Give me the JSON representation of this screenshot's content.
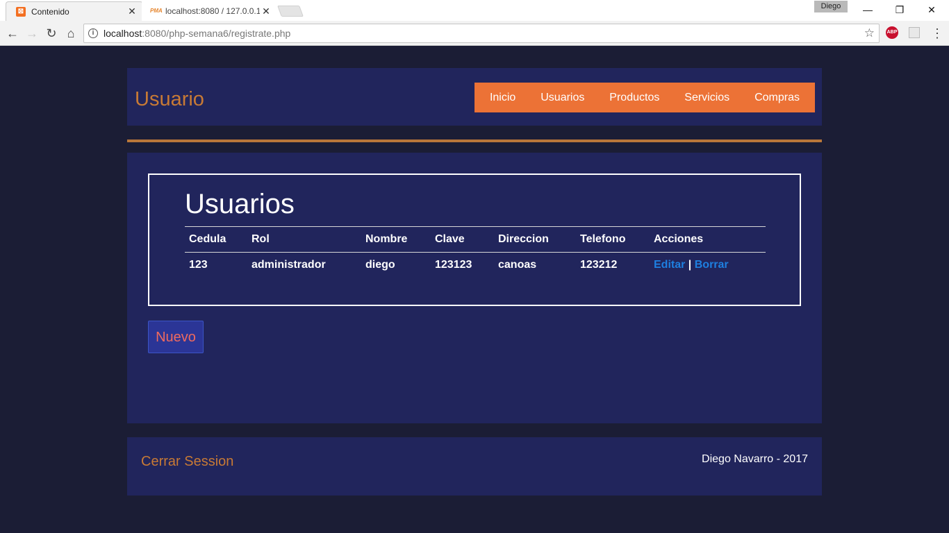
{
  "browser": {
    "tabs": [
      {
        "title": "Contenido",
        "icon": "xampp-icon",
        "active": true
      },
      {
        "title": "localhost:8080 / 127.0.0.1",
        "icon": "phpmyadmin-icon",
        "active": false
      }
    ],
    "profile_name": "Diego",
    "url_host": "localhost",
    "url_path": ":8080/php-semana6/registrate.php",
    "abp_label": "ABP",
    "favicon_xampp_glyph": "⊠",
    "favicon_pma_text": "PMA"
  },
  "header": {
    "site_title": "Usuario",
    "nav": [
      "Inicio",
      "Usuarios",
      "Productos",
      "Servicios",
      "Compras"
    ]
  },
  "main": {
    "title": "Usuarios",
    "columns": [
      "Cedula",
      "Rol",
      "Nombre",
      "Clave",
      "Direccion",
      "Telefono",
      "Acciones"
    ],
    "rows": [
      {
        "cedula": "123",
        "rol": "administrador",
        "nombre": "diego",
        "clave": "123123",
        "direccion": "canoas",
        "telefono": "123212",
        "edit_label": "Editar",
        "separator": "|",
        "delete_label": "Borrar"
      }
    ],
    "new_button": "Nuevo"
  },
  "footer": {
    "logout": "Cerrar Session",
    "copyright": "Diego Navarro - 2017"
  },
  "colors": {
    "page_background": "#1b1d35",
    "panel_background": "#21255c",
    "accent_orange": "#ec7236",
    "title_orange": "#c87a35",
    "link_blue": "#1e7fe0",
    "new_button_text": "#ef6a5f"
  }
}
